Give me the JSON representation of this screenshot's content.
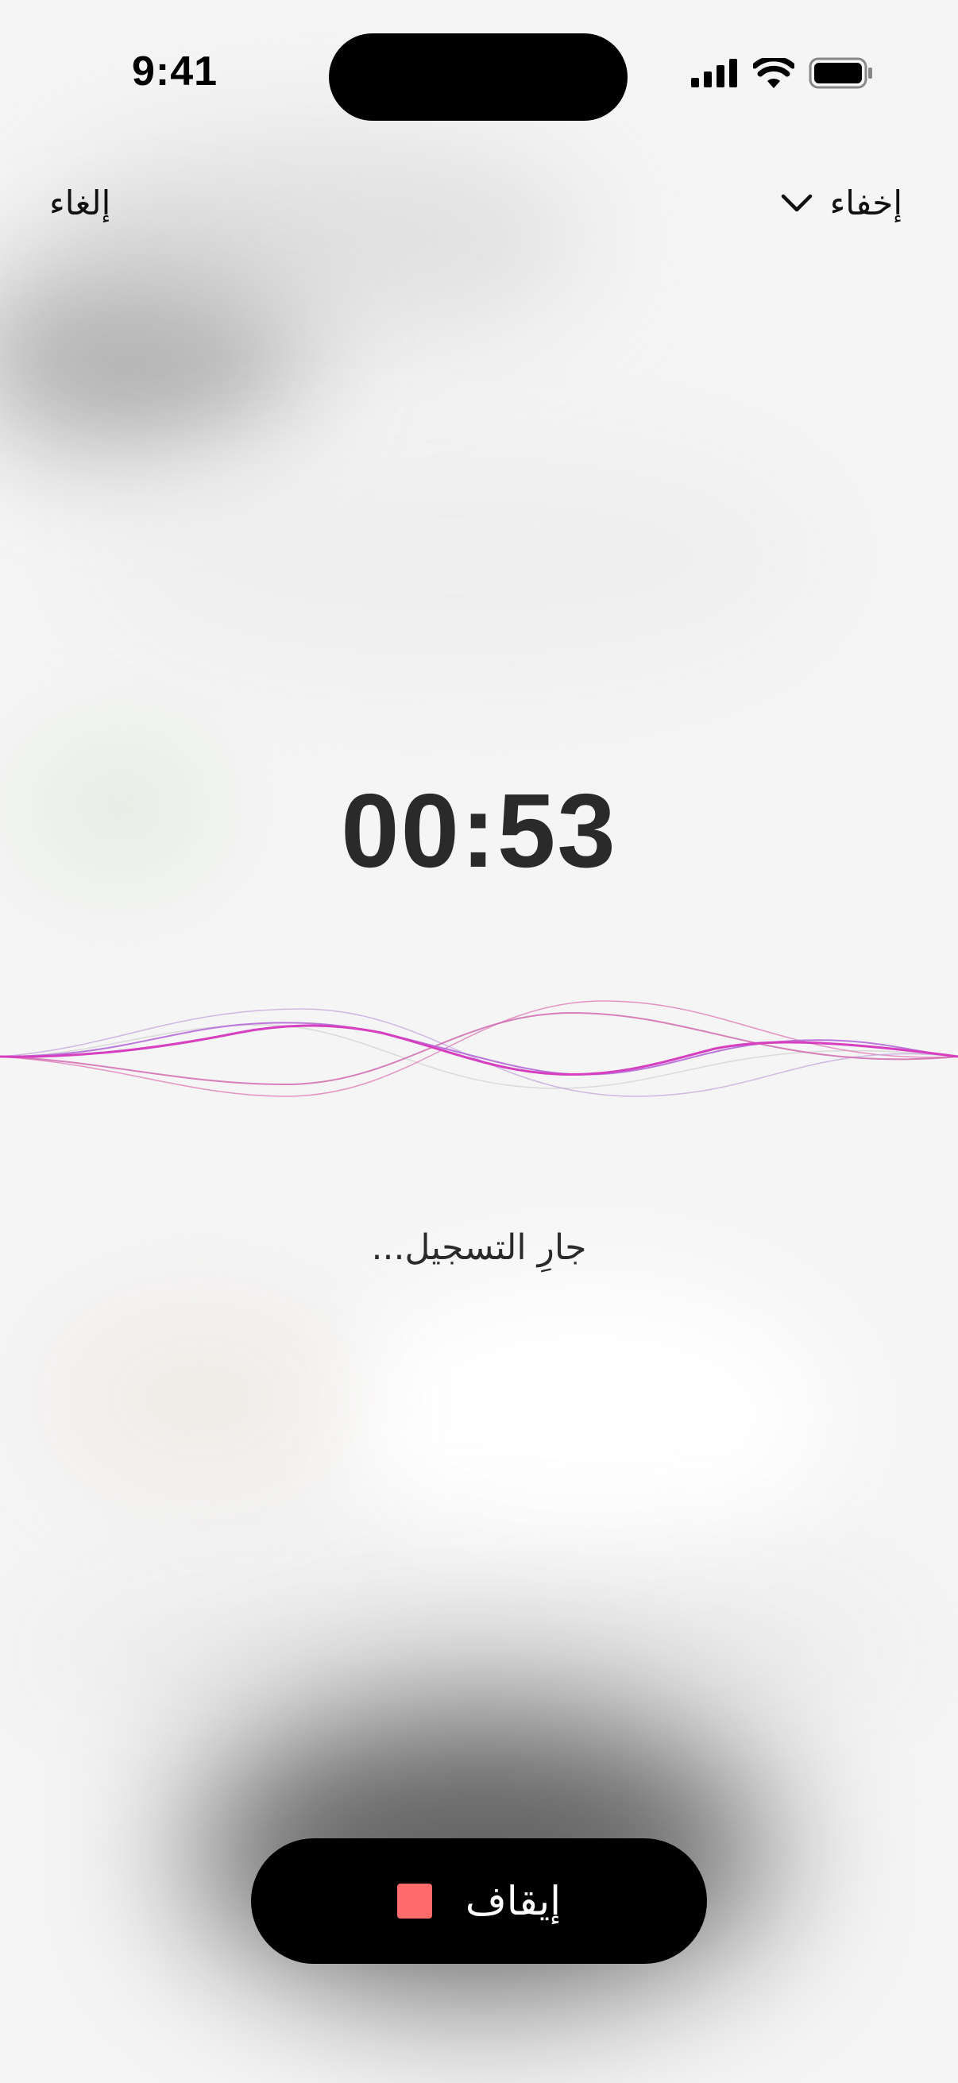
{
  "status_bar": {
    "time": "9:41",
    "icons": [
      "cellular-signal-icon",
      "wifi-icon",
      "battery-icon"
    ]
  },
  "header": {
    "cancel_label": "إلغاء",
    "hide_label": "إخفاء",
    "hide_icon": "chevron-down-icon"
  },
  "recorder": {
    "timer": "00:53",
    "status_text": "جارِ التسجيل...",
    "waveform_colors": [
      "#d63fbf",
      "#b56ad9",
      "#e07ab8",
      "#c5a8e0",
      "#cfcfcf"
    ]
  },
  "controls": {
    "stop_label": "إيقاف",
    "stop_icon": "stop-square-icon",
    "stop_icon_color": "#ff6a6a"
  }
}
